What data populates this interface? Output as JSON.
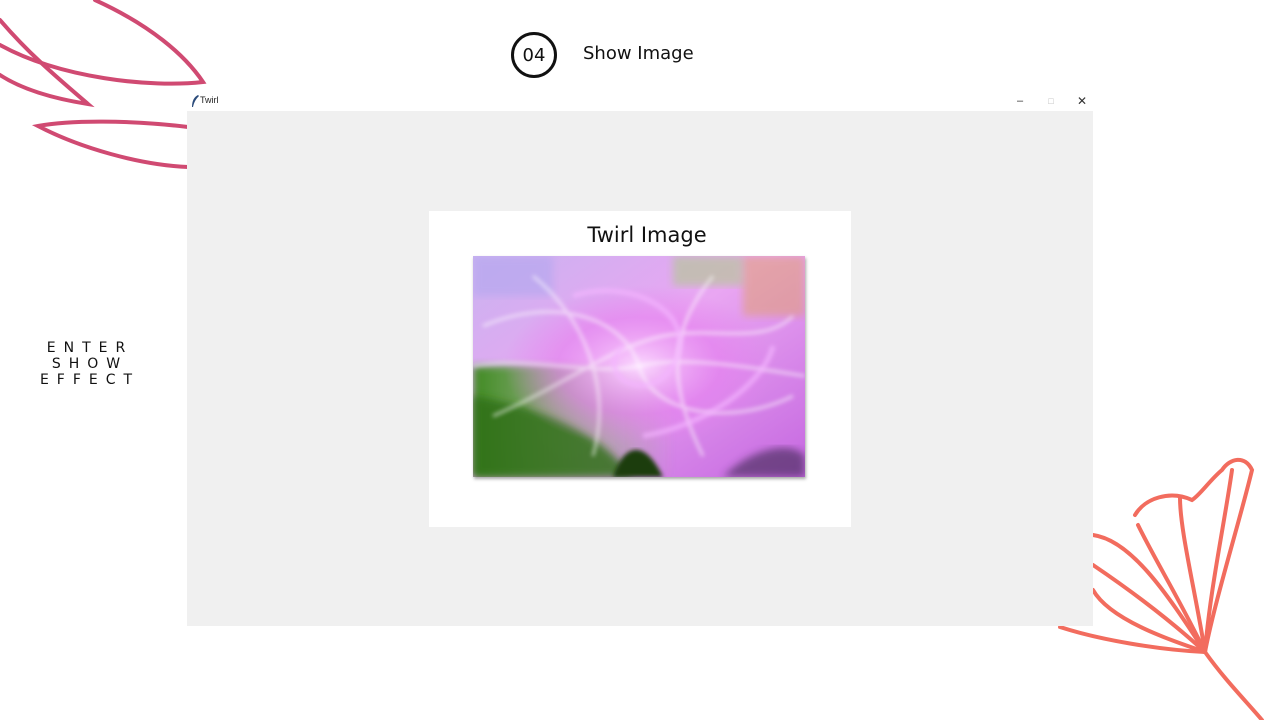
{
  "slide": {
    "step_number": "04",
    "step_title": "Show Image",
    "side_caption_line1": "ENTER SHOW",
    "side_caption_line2": "EFFECT"
  },
  "window": {
    "title": "Twirl",
    "controls": [
      "minimize-icon",
      "maximize-icon",
      "close-icon"
    ]
  },
  "card": {
    "title": "Twirl Image"
  },
  "colors": {
    "leaf_left": "#d04a72",
    "leaf_right": "#f26c5e",
    "window_bg": "#f0f0f0"
  }
}
